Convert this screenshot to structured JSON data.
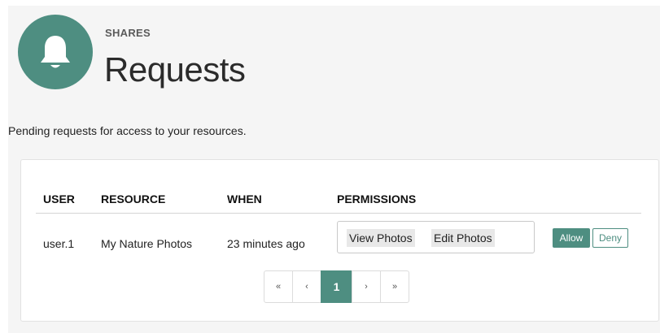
{
  "header": {
    "icon": "bell-icon",
    "section": "SHARES",
    "title": "Requests"
  },
  "subtitle": "Pending requests for access to your resources.",
  "table": {
    "columns": [
      "USER",
      "RESOURCE",
      "WHEN",
      "PERMISSIONS"
    ],
    "rows": [
      {
        "user": "user.1",
        "resource": "My Nature Photos",
        "when": "23 minutes ago",
        "permissions": [
          "View Photos",
          "Edit Photos"
        ],
        "allow_label": "Allow",
        "deny_label": "Deny"
      }
    ]
  },
  "pagination": {
    "first": "«",
    "prev": "‹",
    "current": "1",
    "next": "›",
    "last": "»"
  },
  "colors": {
    "accent": "#4e8e81",
    "background": "#f5f5f5"
  }
}
